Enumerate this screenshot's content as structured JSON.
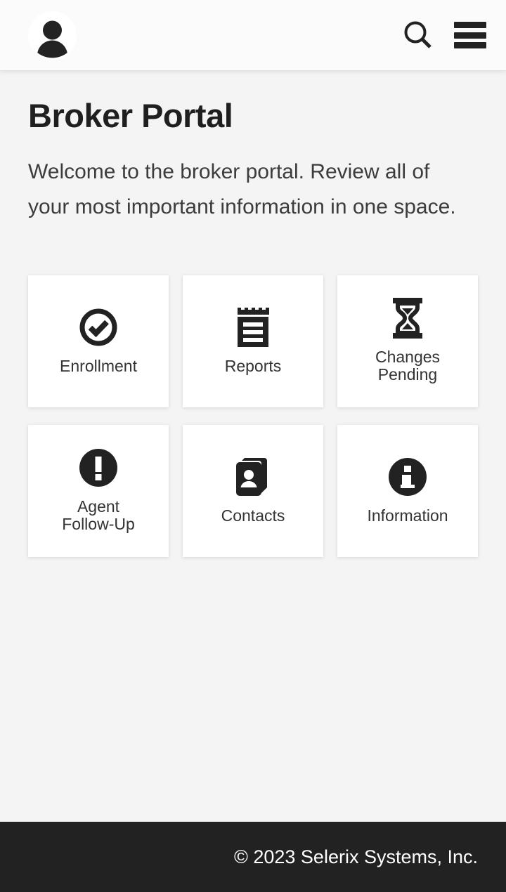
{
  "header": {
    "avatar_alt": "User avatar",
    "search_label": "Search",
    "menu_label": "Menu"
  },
  "main": {
    "title": "Broker Portal",
    "subtitle": "Welcome to the broker portal. Review all of your most important information in one space.",
    "tiles": [
      {
        "label": "Enrollment",
        "icon": "check-circle-icon"
      },
      {
        "label": "Reports",
        "icon": "notepad-icon"
      },
      {
        "label": "Changes\nPending",
        "icon": "hourglass-icon"
      },
      {
        "label": "Agent\nFollow-Up",
        "icon": "exclamation-circle-icon"
      },
      {
        "label": "Contacts",
        "icon": "address-book-icon"
      },
      {
        "label": "Information",
        "icon": "info-circle-icon"
      }
    ]
  },
  "footer": {
    "copyright": "© 2023 Selerix Systems, Inc."
  },
  "colors": {
    "page_background": "#f4f4f4",
    "header_background": "#fbfbfb",
    "footer_background": "#222222",
    "tile_background": "#ffffff",
    "icon": "#222222",
    "title_text": "#1f1f1f",
    "label_text": "#333333",
    "footer_text": "#ffffff"
  }
}
